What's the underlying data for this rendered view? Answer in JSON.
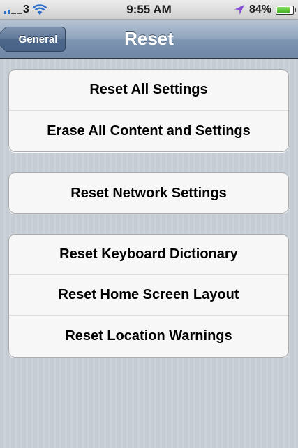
{
  "status_bar": {
    "carrier": "3",
    "time": "9:55 AM",
    "battery_percent": "84%",
    "battery_level": 0.84,
    "signal_icon": "signal-bars-icon",
    "wifi_icon": "wifi-icon",
    "location_icon": "location-arrow-icon",
    "battery_icon": "battery-icon"
  },
  "nav": {
    "title": "Reset",
    "back_label": "General"
  },
  "groups": [
    {
      "items": [
        {
          "label": "Reset All Settings"
        },
        {
          "label": "Erase All Content and Settings"
        }
      ]
    },
    {
      "items": [
        {
          "label": "Reset Network Settings"
        }
      ]
    },
    {
      "items": [
        {
          "label": "Reset Keyboard Dictionary"
        },
        {
          "label": "Reset Home Screen Layout"
        },
        {
          "label": "Reset Location Warnings"
        }
      ]
    }
  ],
  "colors": {
    "nav_bar": "#8ea3bc",
    "background": "#c5ccd4",
    "location_arrow": "#8a4fd8",
    "battery_fill": "#4fbf2a"
  }
}
